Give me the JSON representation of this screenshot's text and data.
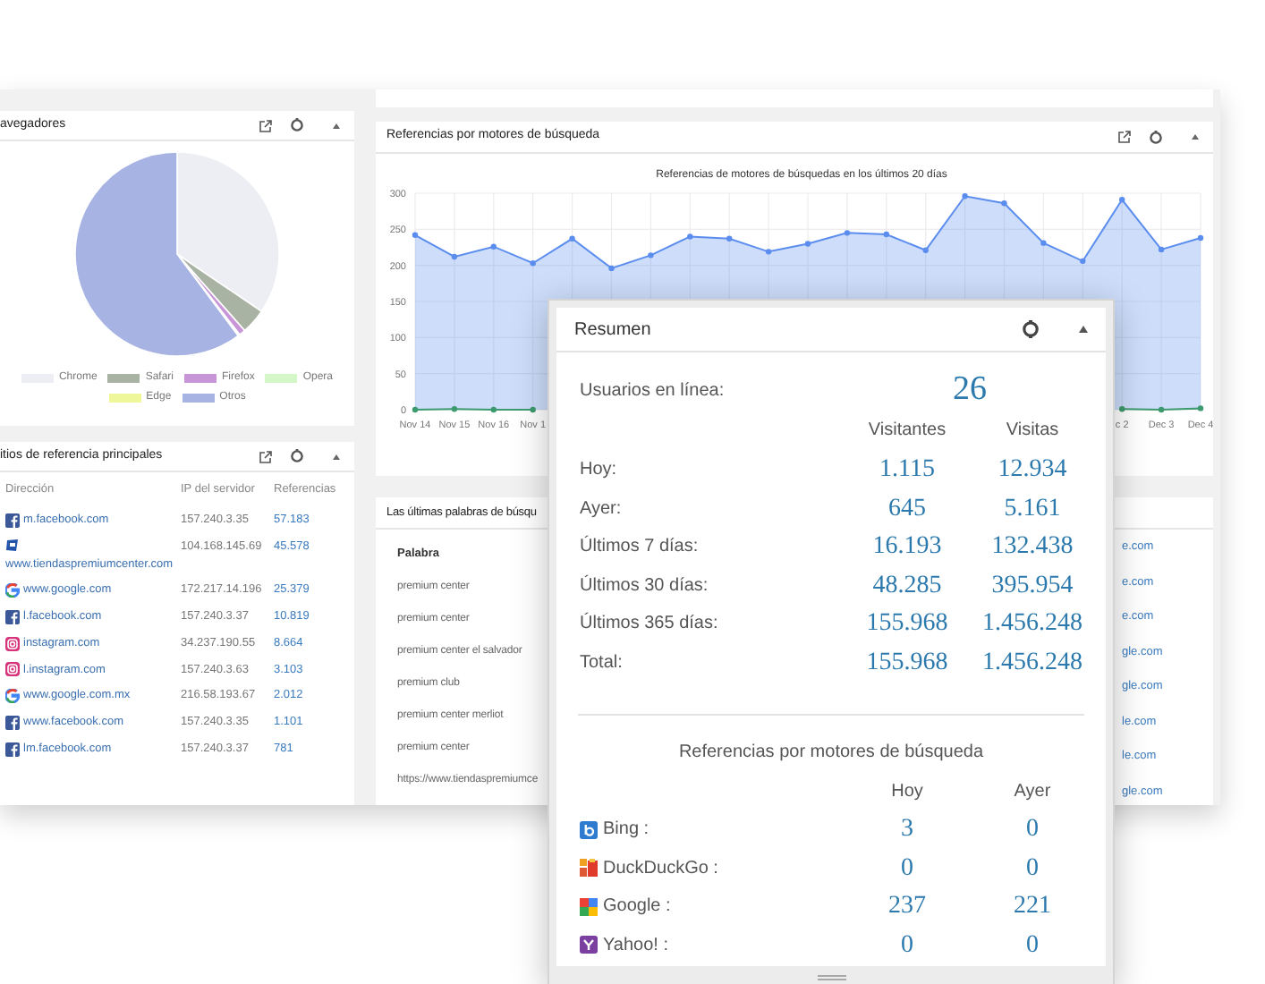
{
  "browsers_panel": {
    "title": "avegadores",
    "legend": [
      {
        "label": "Chrome",
        "color": "#eceef3"
      },
      {
        "label": "Safari",
        "color": "#a9b3a4"
      },
      {
        "label": "Firefox",
        "color": "#c795d8"
      },
      {
        "label": "Opera",
        "color": "#d4f7c8"
      },
      {
        "label": "Edge",
        "color": "#eef79a"
      },
      {
        "label": "Otros",
        "color": "#a6b3e3"
      }
    ]
  },
  "referrers_panel": {
    "title": "itios de referencia principales",
    "columns": [
      "Dirección",
      "IP del servidor",
      "Referencias"
    ],
    "rows": [
      {
        "kind": "facebook",
        "address": "m.facebook.com",
        "ip": "157.240.3.35",
        "references": "57.183"
      },
      {
        "kind": "site",
        "address": "www.tiendaspremiumcenter.com",
        "ip": "104.168.145.69",
        "references": "45.578"
      },
      {
        "kind": "google",
        "address": "www.google.com",
        "ip": "172.217.14.196",
        "references": "25.379"
      },
      {
        "kind": "facebook",
        "address": "l.facebook.com",
        "ip": "157.240.3.37",
        "references": "10.819"
      },
      {
        "kind": "instagram",
        "address": "instagram.com",
        "ip": "34.237.190.55",
        "references": "8.664"
      },
      {
        "kind": "instagram",
        "address": "l.instagram.com",
        "ip": "157.240.3.63",
        "references": "3.103"
      },
      {
        "kind": "google",
        "address": "www.google.com.mx",
        "ip": "216.58.193.67",
        "references": "2.012"
      },
      {
        "kind": "facebook",
        "address": "www.facebook.com",
        "ip": "157.240.3.35",
        "references": "1.101"
      },
      {
        "kind": "facebook",
        "address": "lm.facebook.com",
        "ip": "157.240.3.37",
        "references": "781"
      }
    ]
  },
  "search_engine_panel": {
    "title": "Referencias por motores de búsqueda",
    "chart_data": {
      "type": "area",
      "title": "Referencias de motores de búsquedas en los últimos 20 días",
      "categories": [
        "Nov 14",
        "Nov 15",
        "Nov 16",
        "Nov 1",
        null,
        null,
        null,
        null,
        null,
        null,
        null,
        null,
        null,
        null,
        null,
        null,
        null,
        null,
        "c 2",
        "Dec 3",
        "Dec 4"
      ],
      "series": [
        {
          "color": "#5b8def",
          "values": [
            242,
            212,
            226,
            203,
            237,
            196,
            214,
            240,
            237,
            219,
            230,
            245,
            243,
            221,
            296,
            286,
            231,
            206,
            291,
            222,
            238
          ]
        },
        {
          "color": "#3d9a6e",
          "values": [
            0,
            1,
            0,
            0,
            null,
            null,
            null,
            null,
            null,
            null,
            null,
            null,
            null,
            null,
            null,
            null,
            null,
            null,
            1,
            0,
            2
          ]
        }
      ],
      "ylim": [
        0,
        300
      ],
      "yticks": [
        0,
        50,
        100,
        150,
        200,
        250,
        300
      ],
      "grid": true
    }
  },
  "keywords_panel": {
    "title": "Las últimas palabras de búsqu",
    "column": "Palabra",
    "rows": [
      "premium center",
      "premium center",
      "premium center el salvador",
      "premium club",
      "premium center merliot",
      "premium center",
      "https://www.tiendaspremiumce"
    ],
    "column_2_cells": [
      "e.com",
      "e.com",
      "e.com",
      "gle.com",
      "gle.com",
      "le.com",
      "le.com",
      "gle.com"
    ]
  },
  "summary": {
    "title": "Resumen",
    "online_label": "Usuarios en línea:",
    "online_value": "26",
    "columns": [
      "Visitantes",
      "Visitas"
    ],
    "rows": [
      {
        "label": "Hoy:",
        "visitors": "1.115",
        "visits": "12.934"
      },
      {
        "label": "Ayer:",
        "visitors": "645",
        "visits": "5.161"
      },
      {
        "label": "Últimos 7 días:",
        "visitors": "16.193",
        "visits": "132.438"
      },
      {
        "label": "Últimos 30 días:",
        "visitors": "48.285",
        "visits": "395.954"
      },
      {
        "label": "Últimos 365 días:",
        "visitors": "155.968",
        "visits": "1.456.248"
      },
      {
        "label": "Total:",
        "visitors": "155.968",
        "visits": "1.456.248"
      }
    ],
    "engines_title": "Referencias por motores de búsqueda",
    "engine_columns": [
      "Hoy",
      "Ayer"
    ],
    "engines": [
      {
        "kind": "bing",
        "label": "Bing :",
        "today": "3",
        "yesterday": "0"
      },
      {
        "kind": "duckduckgo",
        "label": "DuckDuckGo :",
        "today": "0",
        "yesterday": "0"
      },
      {
        "kind": "google",
        "label": "Google :",
        "today": "237",
        "yesterday": "221"
      },
      {
        "kind": "yahoo",
        "label": "Yahoo! :",
        "today": "0",
        "yesterday": "0"
      }
    ]
  }
}
